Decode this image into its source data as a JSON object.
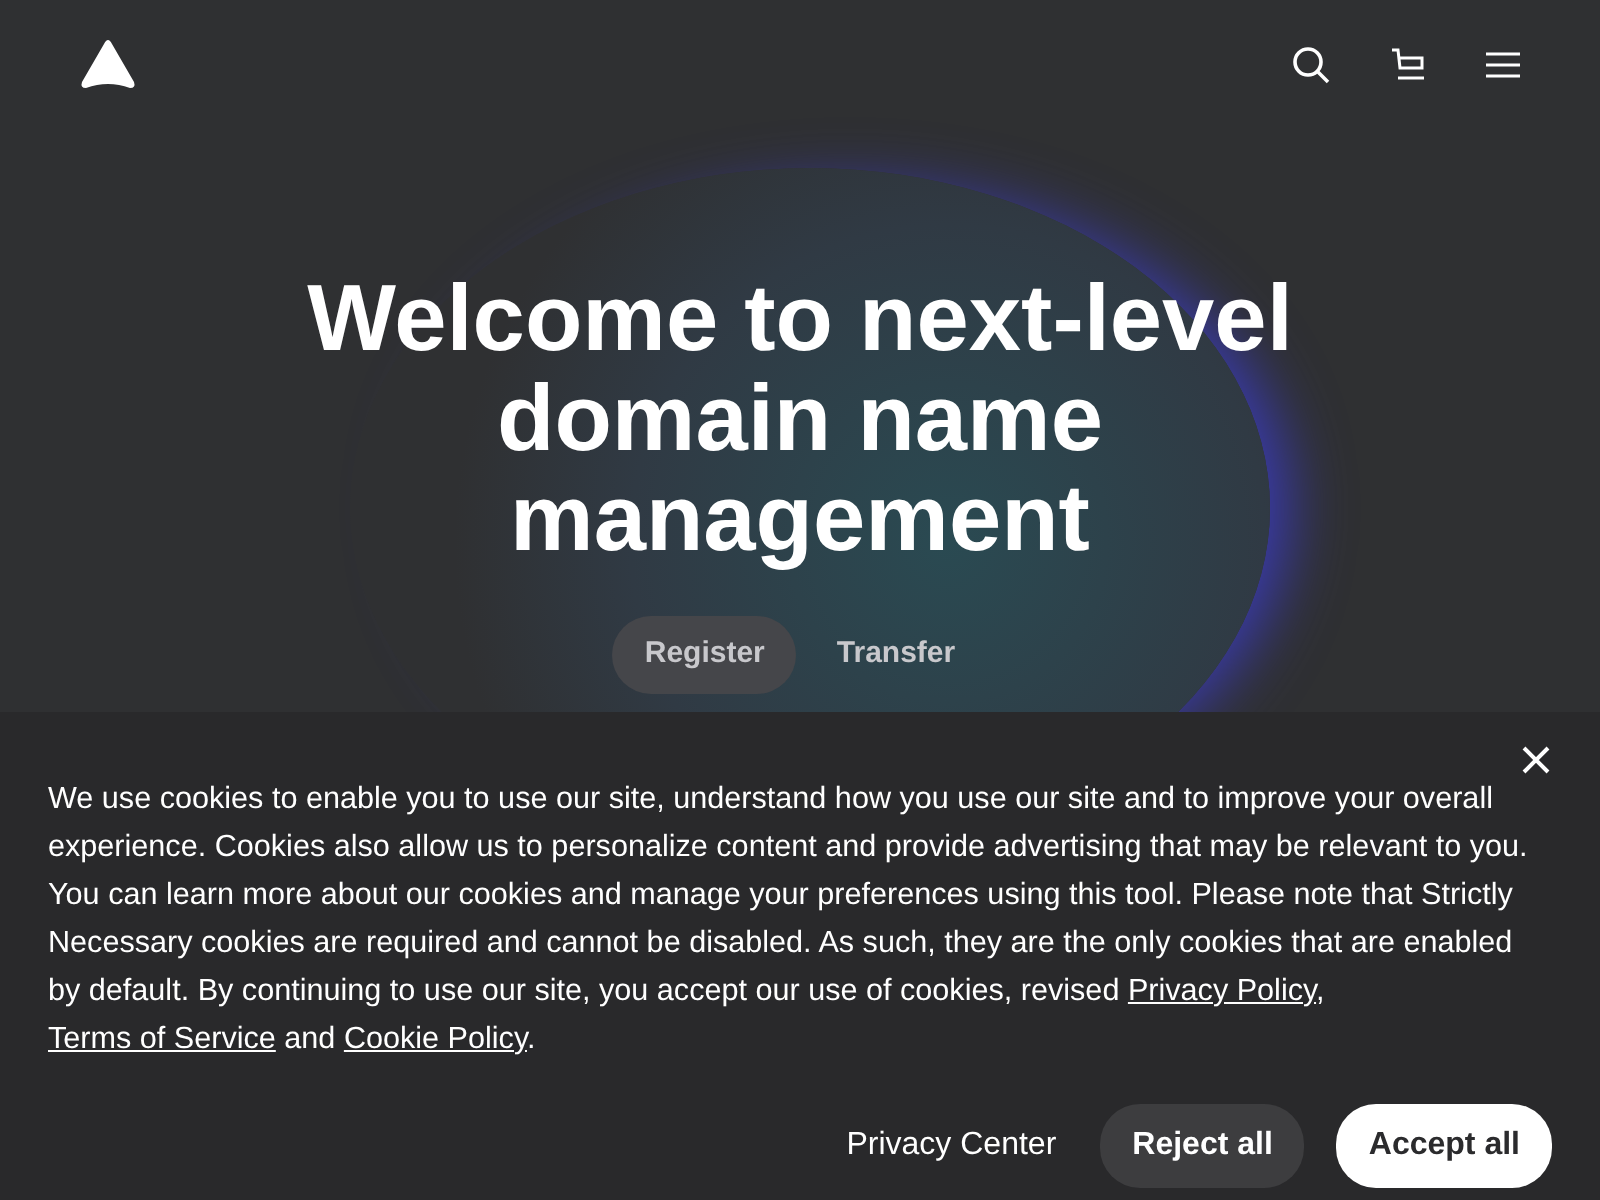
{
  "hero": {
    "title": "Welcome to next-level domain name management",
    "tabs": [
      {
        "label": "Register",
        "selected": true
      },
      {
        "label": "Transfer",
        "selected": false
      }
    ]
  },
  "cookie_banner": {
    "text_before": "We use cookies to enable you to use our site, understand how you use our site and to improve your overall experience. Cookies also allow us to personalize content and provide advertising that may be relevant to you. You can learn more about our cookies and manage your preferences using this tool. Please note that Strictly Necessary cookies are required and cannot be disabled. As such, they are the only cookies that are enabled by default. By continuing to use our site, you accept our use of cookies, revised",
    "links": [
      {
        "label": "Privacy Policy"
      },
      {
        "label": "Terms of Service"
      },
      {
        "label": "Cookie Policy"
      }
    ],
    "joiner_1": ",",
    "joiner_2": "and",
    "end": ".",
    "privacy_center": "Privacy Center",
    "reject": "Reject all",
    "accept": "Accept all"
  }
}
